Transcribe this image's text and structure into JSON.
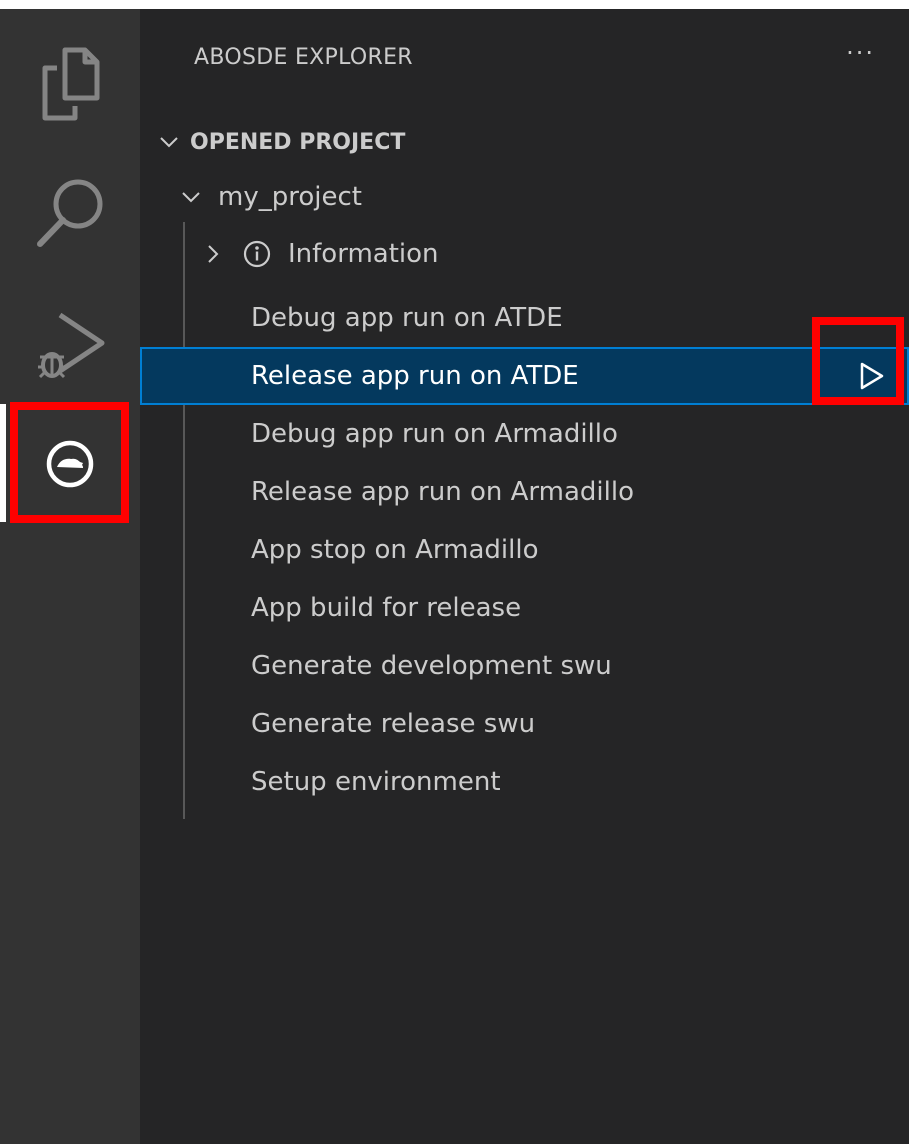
{
  "sidebar": {
    "header": "ABOSDE EXPLORER",
    "more_actions": "···",
    "section": "OPENED PROJECT",
    "project": "my_project",
    "information": "Information",
    "tasks": [
      "Debug app run on ATDE",
      "Release app run on ATDE",
      "Debug app run on Armadillo",
      "Release app run on Armadillo",
      "App stop on Armadillo",
      "App build for release",
      "Generate development swu",
      "Generate release swu",
      "Setup environment"
    ],
    "selected_task_index": 1
  },
  "activity_bar": {
    "items": [
      "files-icon",
      "search-icon",
      "run-debug-icon",
      "abos-extension-icon"
    ],
    "active": "abos-extension-icon"
  },
  "colors": {
    "activity_bar_bg": "#333333",
    "sidebar_bg": "#252526",
    "selection_bg": "#04395e",
    "selection_border": "#007fd4",
    "highlight": "#ff0000",
    "text": "#cccccc"
  }
}
